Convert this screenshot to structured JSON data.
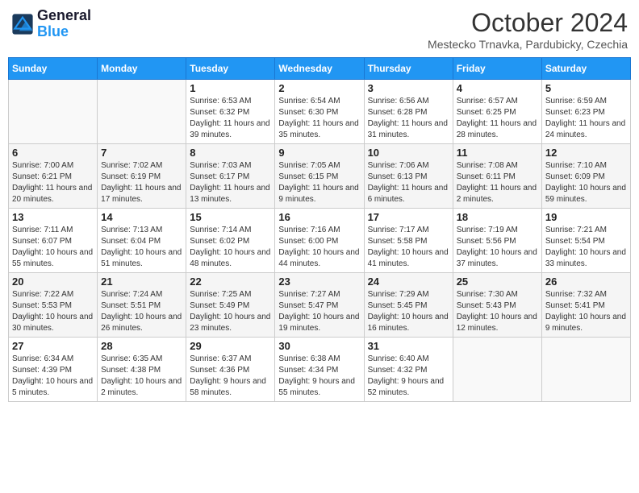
{
  "header": {
    "logo_line1": "General",
    "logo_line2": "Blue",
    "month": "October 2024",
    "location": "Mestecko Trnavka, Pardubicky, Czechia"
  },
  "weekdays": [
    "Sunday",
    "Monday",
    "Tuesday",
    "Wednesday",
    "Thursday",
    "Friday",
    "Saturday"
  ],
  "weeks": [
    [
      {
        "day": "",
        "info": ""
      },
      {
        "day": "",
        "info": ""
      },
      {
        "day": "1",
        "info": "Sunrise: 6:53 AM\nSunset: 6:32 PM\nDaylight: 11 hours and 39 minutes."
      },
      {
        "day": "2",
        "info": "Sunrise: 6:54 AM\nSunset: 6:30 PM\nDaylight: 11 hours and 35 minutes."
      },
      {
        "day": "3",
        "info": "Sunrise: 6:56 AM\nSunset: 6:28 PM\nDaylight: 11 hours and 31 minutes."
      },
      {
        "day": "4",
        "info": "Sunrise: 6:57 AM\nSunset: 6:25 PM\nDaylight: 11 hours and 28 minutes."
      },
      {
        "day": "5",
        "info": "Sunrise: 6:59 AM\nSunset: 6:23 PM\nDaylight: 11 hours and 24 minutes."
      }
    ],
    [
      {
        "day": "6",
        "info": "Sunrise: 7:00 AM\nSunset: 6:21 PM\nDaylight: 11 hours and 20 minutes."
      },
      {
        "day": "7",
        "info": "Sunrise: 7:02 AM\nSunset: 6:19 PM\nDaylight: 11 hours and 17 minutes."
      },
      {
        "day": "8",
        "info": "Sunrise: 7:03 AM\nSunset: 6:17 PM\nDaylight: 11 hours and 13 minutes."
      },
      {
        "day": "9",
        "info": "Sunrise: 7:05 AM\nSunset: 6:15 PM\nDaylight: 11 hours and 9 minutes."
      },
      {
        "day": "10",
        "info": "Sunrise: 7:06 AM\nSunset: 6:13 PM\nDaylight: 11 hours and 6 minutes."
      },
      {
        "day": "11",
        "info": "Sunrise: 7:08 AM\nSunset: 6:11 PM\nDaylight: 11 hours and 2 minutes."
      },
      {
        "day": "12",
        "info": "Sunrise: 7:10 AM\nSunset: 6:09 PM\nDaylight: 10 hours and 59 minutes."
      }
    ],
    [
      {
        "day": "13",
        "info": "Sunrise: 7:11 AM\nSunset: 6:07 PM\nDaylight: 10 hours and 55 minutes."
      },
      {
        "day": "14",
        "info": "Sunrise: 7:13 AM\nSunset: 6:04 PM\nDaylight: 10 hours and 51 minutes."
      },
      {
        "day": "15",
        "info": "Sunrise: 7:14 AM\nSunset: 6:02 PM\nDaylight: 10 hours and 48 minutes."
      },
      {
        "day": "16",
        "info": "Sunrise: 7:16 AM\nSunset: 6:00 PM\nDaylight: 10 hours and 44 minutes."
      },
      {
        "day": "17",
        "info": "Sunrise: 7:17 AM\nSunset: 5:58 PM\nDaylight: 10 hours and 41 minutes."
      },
      {
        "day": "18",
        "info": "Sunrise: 7:19 AM\nSunset: 5:56 PM\nDaylight: 10 hours and 37 minutes."
      },
      {
        "day": "19",
        "info": "Sunrise: 7:21 AM\nSunset: 5:54 PM\nDaylight: 10 hours and 33 minutes."
      }
    ],
    [
      {
        "day": "20",
        "info": "Sunrise: 7:22 AM\nSunset: 5:53 PM\nDaylight: 10 hours and 30 minutes."
      },
      {
        "day": "21",
        "info": "Sunrise: 7:24 AM\nSunset: 5:51 PM\nDaylight: 10 hours and 26 minutes."
      },
      {
        "day": "22",
        "info": "Sunrise: 7:25 AM\nSunset: 5:49 PM\nDaylight: 10 hours and 23 minutes."
      },
      {
        "day": "23",
        "info": "Sunrise: 7:27 AM\nSunset: 5:47 PM\nDaylight: 10 hours and 19 minutes."
      },
      {
        "day": "24",
        "info": "Sunrise: 7:29 AM\nSunset: 5:45 PM\nDaylight: 10 hours and 16 minutes."
      },
      {
        "day": "25",
        "info": "Sunrise: 7:30 AM\nSunset: 5:43 PM\nDaylight: 10 hours and 12 minutes."
      },
      {
        "day": "26",
        "info": "Sunrise: 7:32 AM\nSunset: 5:41 PM\nDaylight: 10 hours and 9 minutes."
      }
    ],
    [
      {
        "day": "27",
        "info": "Sunrise: 6:34 AM\nSunset: 4:39 PM\nDaylight: 10 hours and 5 minutes."
      },
      {
        "day": "28",
        "info": "Sunrise: 6:35 AM\nSunset: 4:38 PM\nDaylight: 10 hours and 2 minutes."
      },
      {
        "day": "29",
        "info": "Sunrise: 6:37 AM\nSunset: 4:36 PM\nDaylight: 9 hours and 58 minutes."
      },
      {
        "day": "30",
        "info": "Sunrise: 6:38 AM\nSunset: 4:34 PM\nDaylight: 9 hours and 55 minutes."
      },
      {
        "day": "31",
        "info": "Sunrise: 6:40 AM\nSunset: 4:32 PM\nDaylight: 9 hours and 52 minutes."
      },
      {
        "day": "",
        "info": ""
      },
      {
        "day": "",
        "info": ""
      }
    ]
  ]
}
